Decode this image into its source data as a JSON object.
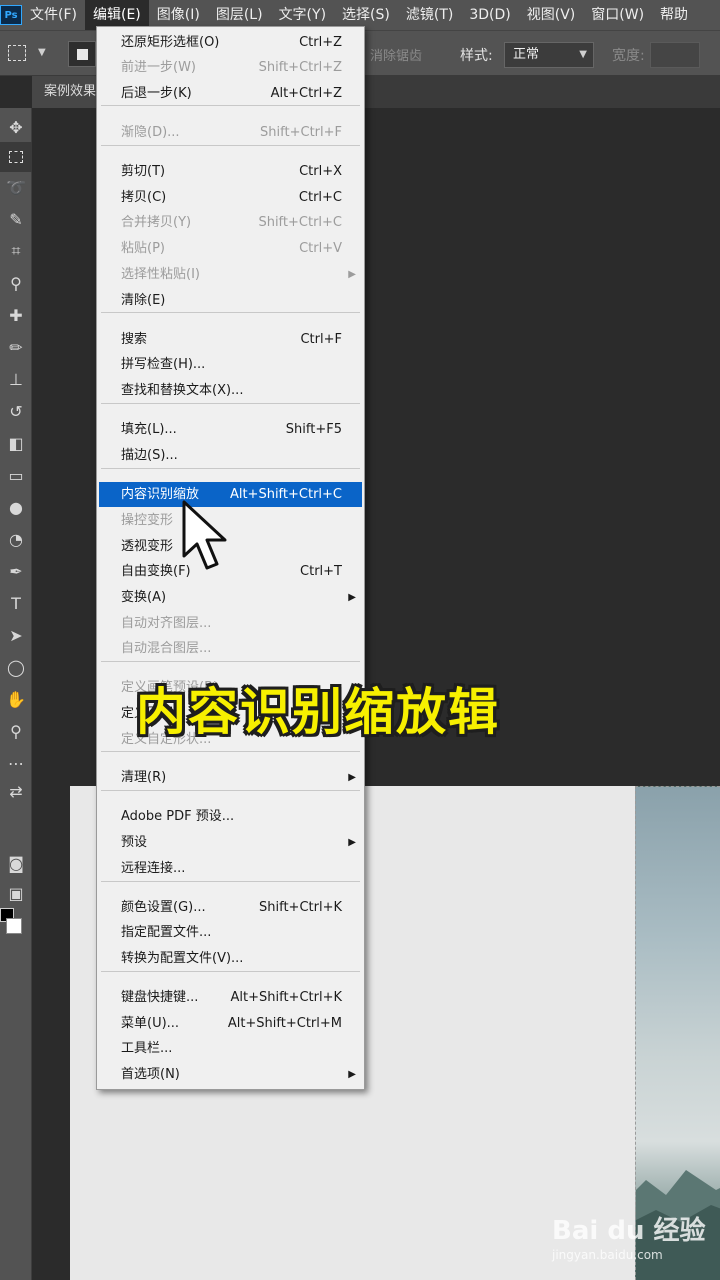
{
  "menubar": {
    "logo": "Ps",
    "items": [
      "文件(F)",
      "编辑(E)",
      "图像(I)",
      "图层(L)",
      "文字(Y)",
      "选择(S)",
      "滤镜(T)",
      "3D(D)",
      "视图(V)",
      "窗口(W)",
      "帮助"
    ]
  },
  "options": {
    "feather_label": "消除锯齿",
    "style_label": "样式:",
    "style_value": "正常",
    "width_label": "宽度:"
  },
  "tab": {
    "label": "案例效果"
  },
  "edit_menu": {
    "items": [
      {
        "label": "还原矩形选框(O)",
        "shortcut": "Ctrl+Z",
        "enabled": true
      },
      {
        "label": "前进一步(W)",
        "shortcut": "Shift+Ctrl+Z",
        "enabled": false
      },
      {
        "label": "后退一步(K)",
        "shortcut": "Alt+Ctrl+Z",
        "enabled": true
      },
      {
        "label": "渐隐(D)...",
        "shortcut": "Shift+Ctrl+F",
        "enabled": false
      },
      {
        "label": "剪切(T)",
        "shortcut": "Ctrl+X",
        "enabled": true
      },
      {
        "label": "拷贝(C)",
        "shortcut": "Ctrl+C",
        "enabled": true
      },
      {
        "label": "合并拷贝(Y)",
        "shortcut": "Shift+Ctrl+C",
        "enabled": false
      },
      {
        "label": "粘贴(P)",
        "shortcut": "Ctrl+V",
        "enabled": false
      },
      {
        "label": "选择性粘贴(I)",
        "shortcut": "",
        "enabled": false,
        "submenu": true
      },
      {
        "label": "清除(E)",
        "shortcut": "",
        "enabled": true
      },
      {
        "label": "搜索",
        "shortcut": "Ctrl+F",
        "enabled": true
      },
      {
        "label": "拼写检查(H)...",
        "shortcut": "",
        "enabled": true
      },
      {
        "label": "查找和替换文本(X)...",
        "shortcut": "",
        "enabled": true
      },
      {
        "label": "填充(L)...",
        "shortcut": "Shift+F5",
        "enabled": true
      },
      {
        "label": "描边(S)...",
        "shortcut": "",
        "enabled": true
      },
      {
        "label": "内容识别缩放",
        "shortcut": "Alt+Shift+Ctrl+C",
        "enabled": true,
        "highlighted": true
      },
      {
        "label": "操控变形",
        "shortcut": "",
        "enabled": false
      },
      {
        "label": "透视变形",
        "shortcut": "",
        "enabled": true
      },
      {
        "label": "自由变换(F)",
        "shortcut": "Ctrl+T",
        "enabled": true
      },
      {
        "label": "变换(A)",
        "shortcut": "",
        "enabled": true,
        "submenu": true
      },
      {
        "label": "自动对齐图层...",
        "shortcut": "",
        "enabled": false
      },
      {
        "label": "自动混合图层...",
        "shortcut": "",
        "enabled": false
      },
      {
        "label": "定义画笔预设(B)...",
        "shortcut": "",
        "enabled": false
      },
      {
        "label": "定义图案...",
        "shortcut": "",
        "enabled": true
      },
      {
        "label": "定义自定形状...",
        "shortcut": "",
        "enabled": false
      },
      {
        "label": "清理(R)",
        "shortcut": "",
        "enabled": true,
        "submenu": true
      },
      {
        "label": "Adobe PDF 预设...",
        "shortcut": "",
        "enabled": true
      },
      {
        "label": "预设",
        "shortcut": "",
        "enabled": true,
        "submenu": true
      },
      {
        "label": "远程连接...",
        "shortcut": "",
        "enabled": true
      },
      {
        "label": "颜色设置(G)...",
        "shortcut": "Shift+Ctrl+K",
        "enabled": true
      },
      {
        "label": "指定配置文件...",
        "shortcut": "",
        "enabled": true
      },
      {
        "label": "转换为配置文件(V)...",
        "shortcut": "",
        "enabled": true
      },
      {
        "label": "键盘快捷键...",
        "shortcut": "Alt+Shift+Ctrl+K",
        "enabled": true
      },
      {
        "label": "菜单(U)...",
        "shortcut": "Alt+Shift+Ctrl+M",
        "enabled": true
      },
      {
        "label": "工具栏...",
        "shortcut": "",
        "enabled": true
      },
      {
        "label": "首选项(N)",
        "shortcut": "",
        "enabled": true,
        "submenu": true
      }
    ]
  },
  "caption": "内容识别缩放辑",
  "watermark": {
    "main": "Bai du 经验",
    "sub": "jingyan.baidu.com"
  },
  "colors": {
    "highlight": "#0a64c8",
    "caption": "#f7f000",
    "menu_bg": "#f0f0f0"
  }
}
